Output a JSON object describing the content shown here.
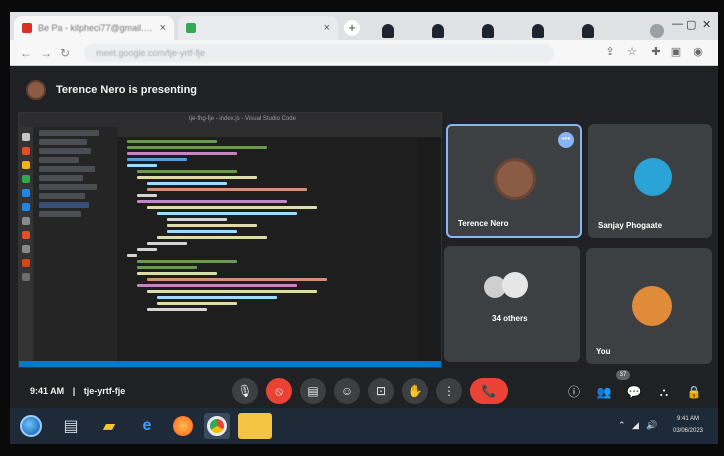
{
  "browser": {
    "tabs": [
      {
        "title": "Be Pa - kilpheci77@gmail.com",
        "favicon_color": "#d93025",
        "close": "×"
      },
      {
        "title": "",
        "favicon_color": "#34a853",
        "close": "×"
      }
    ],
    "new_tab": "+",
    "address_text": "meet.google.com/tje-yrtf-fje",
    "nav": {
      "back": "←",
      "forward": "→",
      "reload": "↻"
    },
    "window_controls": {
      "minimize": "—",
      "maximize": "▢",
      "close": "✕"
    }
  },
  "meet": {
    "presenter_banner": "Terence Nero is presenting",
    "participants": [
      {
        "name": "Terence Nero",
        "active": true,
        "avatar_color": "#8a5b45",
        "more": "•••"
      },
      {
        "name": "Sanjay Phogaate",
        "active": false,
        "avatar_color": "#2aa4d6"
      },
      {
        "name": "34 others",
        "active": false,
        "avatar_color": "#d8d8d8"
      },
      {
        "name": "You",
        "active": false,
        "avatar_color": "#e08b3a"
      }
    ],
    "time": "9:41 AM",
    "separator": "|",
    "meeting_code": "tje-yrtf-fje",
    "controls": {
      "mic": "🎙",
      "camera": "⦸",
      "captions": "▤",
      "reactions": "☺",
      "present": "⊡",
      "raise_hand": "✋",
      "more": "⋮",
      "leave": "📞"
    },
    "right_controls": {
      "info": "ⓘ",
      "people": "👥",
      "chat": "💬",
      "activities": "⛬",
      "host_controls": "🔒"
    },
    "people_count_badge": "37"
  },
  "vscode": {
    "window_title": "tje-fhg-fje - index.js - Visual Studio Code"
  },
  "taskbar": {
    "items": [
      "start-orb",
      "task-view",
      "file-explorer",
      "edge",
      "firefox",
      "chrome",
      "sticky-notes"
    ],
    "clock_time": "9:41 AM",
    "clock_date": "03/06/2023",
    "tray": {
      "chevron": "⌃",
      "network": "◢",
      "volume": "🔊"
    }
  }
}
